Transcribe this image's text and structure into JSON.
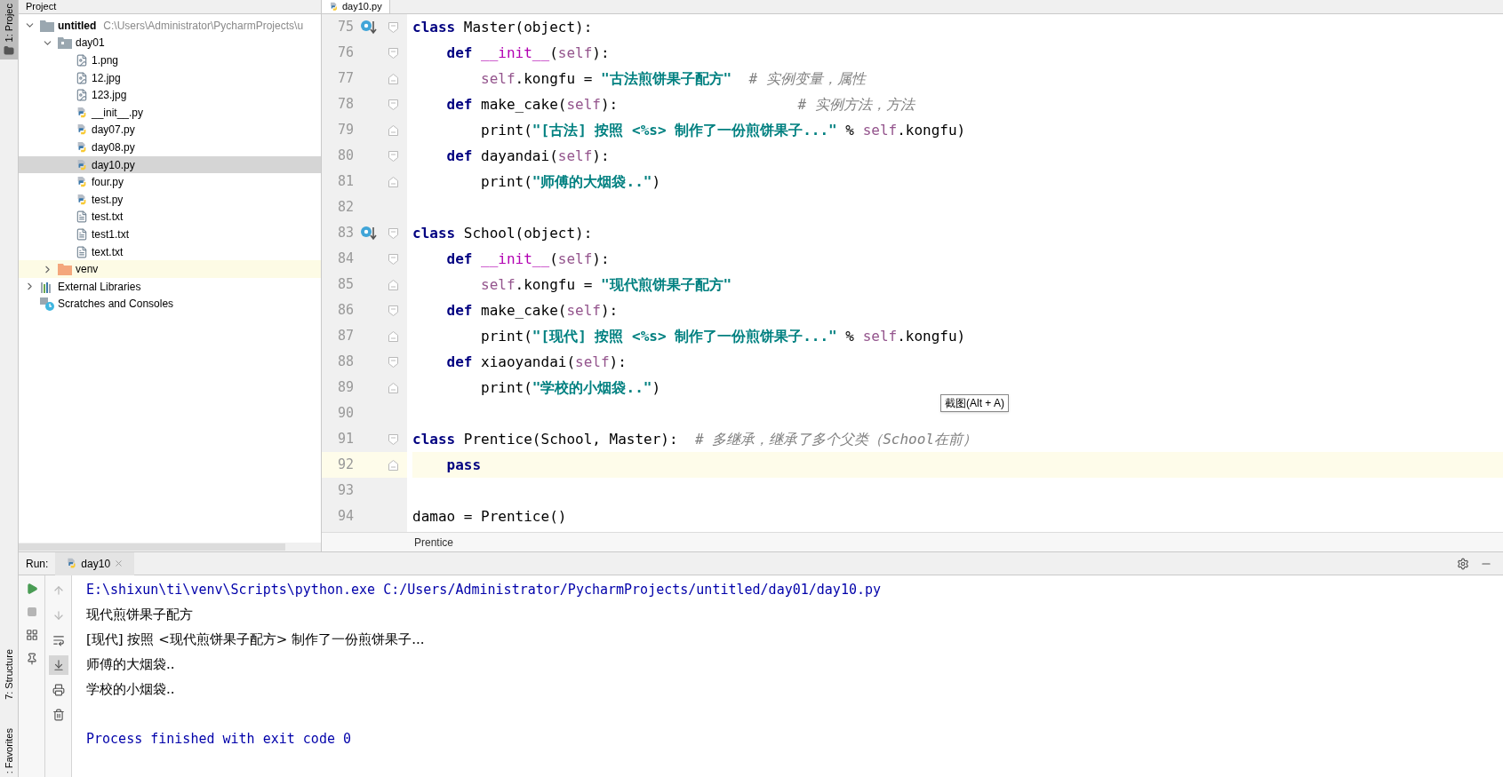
{
  "tool_strip": {
    "top": [
      {
        "label": "1: Projec",
        "selected": true
      }
    ],
    "bottom": [
      {
        "label": "7: Structure",
        "selected": false
      },
      {
        "label": ": Favorites",
        "selected": false
      }
    ]
  },
  "project_panel": {
    "title": "Project",
    "tree": [
      {
        "label": "untitled",
        "path": "C:\\Users\\Administrator\\PycharmProjects\\u",
        "kind": "project",
        "expanded": true,
        "selected": false,
        "children": [
          {
            "label": "day01",
            "kind": "folder",
            "expanded": true,
            "selected": false,
            "children": [
              {
                "label": "1.png",
                "kind": "image",
                "selected": false
              },
              {
                "label": "12.jpg",
                "kind": "image",
                "selected": false
              },
              {
                "label": "123.jpg",
                "kind": "image",
                "selected": false
              },
              {
                "label": "__init__.py",
                "kind": "python",
                "selected": false
              },
              {
                "label": "day07.py",
                "kind": "python",
                "selected": false
              },
              {
                "label": "day08.py",
                "kind": "python",
                "selected": false
              },
              {
                "label": "day10.py",
                "kind": "python",
                "selected": true
              },
              {
                "label": "four.py",
                "kind": "python",
                "selected": false
              },
              {
                "label": "test.py",
                "kind": "python",
                "selected": false
              },
              {
                "label": "test.txt",
                "kind": "text",
                "selected": false
              },
              {
                "label": "test1.txt",
                "kind": "text",
                "selected": false
              },
              {
                "label": "text.txt",
                "kind": "text",
                "selected": false
              }
            ]
          },
          {
            "label": "venv",
            "kind": "excluded-folder",
            "expanded": false,
            "selected": false
          }
        ]
      },
      {
        "label": "External Libraries",
        "kind": "libraries",
        "expanded": false,
        "selected": false
      },
      {
        "label": "Scratches and Consoles",
        "kind": "scratches",
        "selected": false
      }
    ]
  },
  "editor": {
    "tabs": [
      {
        "label": "day10.py",
        "selected": true
      }
    ],
    "lines": [
      {
        "number": "75",
        "override": true,
        "fold_start": true,
        "fold_end": false,
        "current": false,
        "tokens": [
          {
            "text": "class ",
            "kind": "keyword"
          },
          {
            "text": "Master(object):",
            "kind": "plain"
          }
        ]
      },
      {
        "number": "76",
        "override": false,
        "fold_start": true,
        "fold_end": false,
        "current": false,
        "tokens": [
          {
            "text": "    def ",
            "kind": "keyword"
          },
          {
            "text": "__init__",
            "kind": "magic"
          },
          {
            "text": "(",
            "kind": "plain"
          },
          {
            "text": "self",
            "kind": "self"
          },
          {
            "text": "):",
            "kind": "plain"
          }
        ]
      },
      {
        "number": "77",
        "override": false,
        "fold_start": false,
        "fold_end": true,
        "current": false,
        "tokens": [
          {
            "text": "        self",
            "kind": "self"
          },
          {
            "text": ".kongfu = ",
            "kind": "plain"
          },
          {
            "text": "\"古法煎饼果子配方\"",
            "kind": "string"
          },
          {
            "text": "  # 实例变量，属性",
            "kind": "comment"
          }
        ]
      },
      {
        "number": "78",
        "override": false,
        "fold_start": true,
        "fold_end": false,
        "current": false,
        "tokens": [
          {
            "text": "    def ",
            "kind": "keyword"
          },
          {
            "text": "make_cake(",
            "kind": "plain"
          },
          {
            "text": "self",
            "kind": "self"
          },
          {
            "text": "):",
            "kind": "plain"
          },
          {
            "text": "                     # 实例方法，方法",
            "kind": "comment"
          }
        ]
      },
      {
        "number": "79",
        "override": false,
        "fold_start": false,
        "fold_end": true,
        "current": false,
        "tokens": [
          {
            "text": "        print(",
            "kind": "plain"
          },
          {
            "text": "\"[古法] 按照 <%s> 制作了一份煎饼果子...\"",
            "kind": "string"
          },
          {
            "text": " % ",
            "kind": "plain"
          },
          {
            "text": "self",
            "kind": "self"
          },
          {
            "text": ".kongfu)",
            "kind": "plain"
          }
        ]
      },
      {
        "number": "80",
        "override": false,
        "fold_start": true,
        "fold_end": false,
        "current": false,
        "tokens": [
          {
            "text": "    def ",
            "kind": "keyword"
          },
          {
            "text": "dayandai(",
            "kind": "plain"
          },
          {
            "text": "self",
            "kind": "self"
          },
          {
            "text": "):",
            "kind": "plain"
          }
        ]
      },
      {
        "number": "81",
        "override": false,
        "fold_start": false,
        "fold_end": true,
        "current": false,
        "tokens": [
          {
            "text": "        print(",
            "kind": "plain"
          },
          {
            "text": "\"师傅的大烟袋..\"",
            "kind": "string"
          },
          {
            "text": ")",
            "kind": "plain"
          }
        ]
      },
      {
        "number": "82",
        "override": false,
        "fold_start": false,
        "fold_end": false,
        "current": false
      },
      {
        "number": "83",
        "override": true,
        "fold_start": true,
        "fold_end": false,
        "current": false,
        "tokens": [
          {
            "text": "class ",
            "kind": "keyword"
          },
          {
            "text": "School(object):",
            "kind": "plain"
          }
        ]
      },
      {
        "number": "84",
        "override": false,
        "fold_start": true,
        "fold_end": false,
        "current": false,
        "tokens": [
          {
            "text": "    def ",
            "kind": "keyword"
          },
          {
            "text": "__init__",
            "kind": "magic"
          },
          {
            "text": "(",
            "kind": "plain"
          },
          {
            "text": "self",
            "kind": "self"
          },
          {
            "text": "):",
            "kind": "plain"
          }
        ]
      },
      {
        "number": "85",
        "override": false,
        "fold_start": false,
        "fold_end": true,
        "current": false,
        "tokens": [
          {
            "text": "        self",
            "kind": "self"
          },
          {
            "text": ".kongfu = ",
            "kind": "plain"
          },
          {
            "text": "\"现代煎饼果子配方\"",
            "kind": "string"
          }
        ]
      },
      {
        "number": "86",
        "override": false,
        "fold_start": true,
        "fold_end": false,
        "current": false,
        "tokens": [
          {
            "text": "    def ",
            "kind": "keyword"
          },
          {
            "text": "make_cake(",
            "kind": "plain"
          },
          {
            "text": "self",
            "kind": "self"
          },
          {
            "text": "):",
            "kind": "plain"
          }
        ]
      },
      {
        "number": "87",
        "override": false,
        "fold_start": false,
        "fold_end": true,
        "current": false,
        "tokens": [
          {
            "text": "        print(",
            "kind": "plain"
          },
          {
            "text": "\"[现代] 按照 <%s> 制作了一份煎饼果子...\"",
            "kind": "string"
          },
          {
            "text": " % ",
            "kind": "plain"
          },
          {
            "text": "self",
            "kind": "self"
          },
          {
            "text": ".kongfu)",
            "kind": "plain"
          }
        ]
      },
      {
        "number": "88",
        "override": false,
        "fold_start": true,
        "fold_end": false,
        "current": false,
        "tokens": [
          {
            "text": "    def ",
            "kind": "keyword"
          },
          {
            "text": "xiaoyandai(",
            "kind": "plain"
          },
          {
            "text": "self",
            "kind": "self"
          },
          {
            "text": "):",
            "kind": "plain"
          }
        ]
      },
      {
        "number": "89",
        "override": false,
        "fold_start": false,
        "fold_end": true,
        "current": false,
        "tokens": [
          {
            "text": "        print(",
            "kind": "plain"
          },
          {
            "text": "\"学校的小烟袋..\"",
            "kind": "string"
          },
          {
            "text": ")",
            "kind": "plain"
          }
        ]
      },
      {
        "number": "90",
        "override": false,
        "fold_start": false,
        "fold_end": false,
        "current": false
      },
      {
        "number": "91",
        "override": false,
        "fold_start": true,
        "fold_end": false,
        "current": false,
        "tokens": [
          {
            "text": "class ",
            "kind": "keyword"
          },
          {
            "text": "Prentice(School, Master):",
            "kind": "plain"
          },
          {
            "text": "  # 多继承，继承了多个父类（School在前）",
            "kind": "comment"
          }
        ]
      },
      {
        "number": "92",
        "override": false,
        "fold_start": false,
        "fold_end": true,
        "current": true,
        "tokens": [
          {
            "text": "    pass",
            "kind": "keyword"
          }
        ]
      },
      {
        "number": "93",
        "override": false,
        "fold_start": false,
        "fold_end": false,
        "current": false
      },
      {
        "number": "94",
        "override": false,
        "fold_start": false,
        "fold_end": false,
        "current": false,
        "tokens": [
          {
            "text": "damao = Prentice()",
            "kind": "plain"
          }
        ]
      }
    ],
    "breadcrumb": "Prentice",
    "tooltip": "截图(Alt + A)"
  },
  "run": {
    "label": "Run:",
    "tabs": [
      {
        "label": "day10",
        "selected": true
      }
    ],
    "tools_left": [
      {
        "kind": "rerun",
        "disabled": false
      },
      {
        "kind": "stop",
        "disabled": true
      },
      {
        "kind": "layout",
        "disabled": false
      },
      {
        "kind": "pin",
        "disabled": false
      }
    ],
    "tools_right": [
      {
        "kind": "up",
        "disabled": true,
        "selected": false
      },
      {
        "kind": "down",
        "disabled": true,
        "selected": false
      },
      {
        "kind": "wrap",
        "disabled": false,
        "selected": false
      },
      {
        "kind": "scroll-end",
        "disabled": false,
        "selected": true
      },
      {
        "kind": "print",
        "disabled": false,
        "selected": false
      },
      {
        "kind": "trash",
        "disabled": false,
        "selected": false
      }
    ],
    "console": [
      {
        "kind": "system",
        "text": "E:\\shixun\\ti\\venv\\Scripts\\python.exe C:/Users/Administrator/PycharmProjects/untitled/day01/day10.py"
      },
      {
        "kind": "output",
        "text": "现代煎饼果子配方"
      },
      {
        "kind": "output",
        "text": "[现代] 按照 <现代煎饼果子配方> 制作了一份煎饼果子..."
      },
      {
        "kind": "output",
        "text": "师傅的大烟袋.."
      },
      {
        "kind": "output",
        "text": "学校的小烟袋.."
      },
      {
        "kind": "blank"
      },
      {
        "kind": "system",
        "text": "Process finished with exit code 0"
      }
    ]
  }
}
